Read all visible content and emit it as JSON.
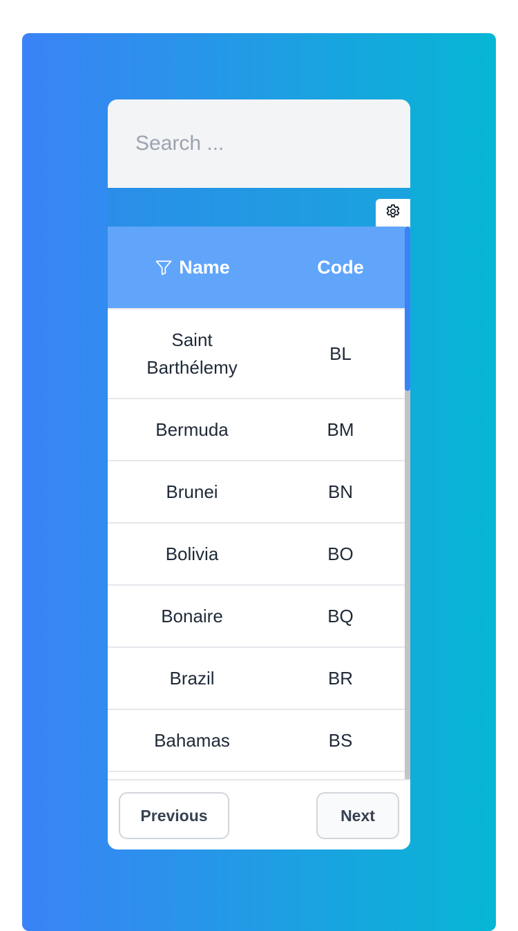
{
  "search": {
    "placeholder": "Search ...",
    "value": ""
  },
  "toolbar": {
    "settings_icon": "gear-icon"
  },
  "table": {
    "headers": {
      "name": "Name",
      "code": "Code",
      "name_icon": "filter-icon"
    },
    "rows": [
      {
        "name": "Saint Barthélemy",
        "code": "BL"
      },
      {
        "name": "Bermuda",
        "code": "BM"
      },
      {
        "name": "Brunei",
        "code": "BN"
      },
      {
        "name": "Bolivia",
        "code": "BO"
      },
      {
        "name": "Bonaire",
        "code": "BQ"
      },
      {
        "name": "Brazil",
        "code": "BR"
      },
      {
        "name": "Bahamas",
        "code": "BS"
      }
    ]
  },
  "pagination": {
    "previous_label": "Previous",
    "next_label": "Next"
  },
  "colors": {
    "gradient_start": "#3b82f6",
    "gradient_end": "#06b6d4",
    "header_bg": "#60a5fa",
    "search_bg": "#f3f4f6",
    "scroll_thumb": "#3b82f6"
  }
}
